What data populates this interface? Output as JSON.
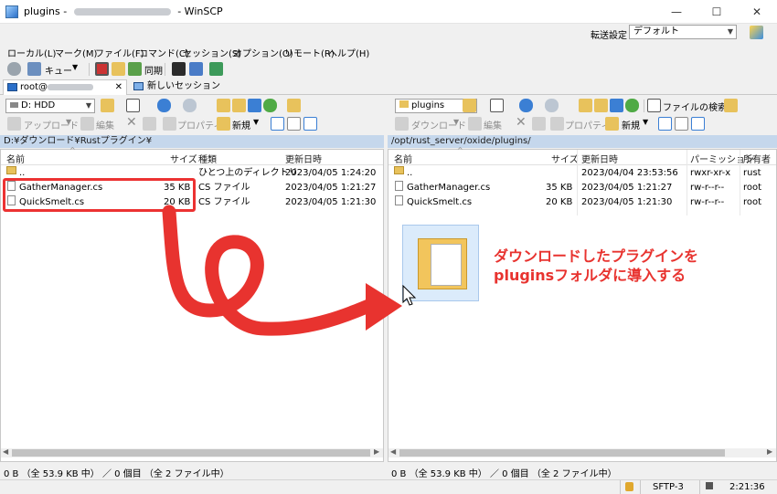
{
  "window": {
    "title_prefix": "plugins - ",
    "title_suffix": " - WinSCP",
    "minimize": "—",
    "maximize": "☐",
    "close": "✕"
  },
  "transfer": {
    "label": "転送設定",
    "value": "デフォルト"
  },
  "menu": [
    "ローカル(L)",
    "マーク(M)",
    "ファイル(F)",
    "コマンド(C)",
    "セッション(S)",
    "オプション(O)",
    "リモート(R)",
    "ヘルプ(H)"
  ],
  "toolbar2": {
    "queue": "キュー",
    "sync": "同期"
  },
  "tabs": {
    "session": "root@",
    "session_close": "✕",
    "new_session": "新しいセッション"
  },
  "local": {
    "drive": "D: HDD",
    "upload": "アップロード",
    "edit": "編集",
    "properties": "プロパティ",
    "new": "新規",
    "path": "D:¥ダウンロード¥Rustプラグイン¥",
    "columns": {
      "name": "名前",
      "size": "サイズ",
      "type": "種類",
      "modified": "更新日時"
    },
    "files": [
      {
        "name": "..",
        "size": "",
        "type": "ひとつ上のディレクトリ",
        "modified": "2023/04/05  1:24:20"
      },
      {
        "name": "GatherManager.cs",
        "size": "35 KB",
        "type": "CS ファイル",
        "modified": "2023/04/05  1:21:27"
      },
      {
        "name": "QuickSmelt.cs",
        "size": "20 KB",
        "type": "CS ファイル",
        "modified": "2023/04/05  1:21:30"
      }
    ],
    "status": "0 B （全 53.9 KB 中） ／ 0 個目 （全 2 ファイル中）"
  },
  "remote": {
    "folder": "plugins",
    "find": "ファイルの検索",
    "download": "ダウンロード",
    "edit": "編集",
    "properties": "プロパティ",
    "new": "新規",
    "path": "/opt/rust_server/oxide/plugins/",
    "columns": {
      "name": "名前",
      "size": "サイズ",
      "modified": "更新日時",
      "permissions": "パーミッション",
      "owner": "所有者"
    },
    "files": [
      {
        "name": "..",
        "size": "",
        "modified": "2023/04/04 23:53:56",
        "permissions": "rwxr-xr-x",
        "owner": "rust"
      },
      {
        "name": "GatherManager.cs",
        "size": "35 KB",
        "modified": "2023/04/05  1:21:27",
        "permissions": "rw-r--r--",
        "owner": "root"
      },
      {
        "name": "QuickSmelt.cs",
        "size": "20 KB",
        "modified": "2023/04/05  1:21:30",
        "permissions": "rw-r--r--",
        "owner": "root"
      }
    ],
    "status": "0 B （全 53.9 KB 中） ／ 0 個目 （全 2 ファイル中）"
  },
  "bottom": {
    "protocol": "SFTP-3",
    "time": "2:21:36"
  },
  "annotation": {
    "line1": "ダウンロードしたプラグインを",
    "line2": "pluginsフォルダに導入する"
  },
  "colors": {
    "accent_red": "#e8332f",
    "path_bg": "#c5d7ec"
  }
}
